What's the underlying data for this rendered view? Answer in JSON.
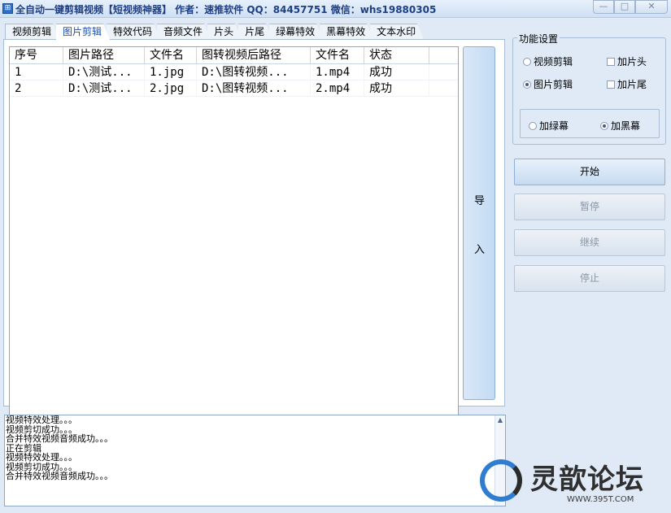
{
  "window": {
    "title": "全自动一键剪辑视频【短视频神器】   作者：速推软件  QQ：84457751  微信：whs19880305",
    "controls": {
      "minimize": "—",
      "maximize": "□",
      "close": "✕"
    }
  },
  "tabs": [
    "视频剪辑",
    "图片剪辑",
    "特效代码",
    "音频文件",
    "片头",
    "片尾",
    "绿幕特效",
    "黑幕特效",
    "文本水印"
  ],
  "active_tab": "图片剪辑",
  "table": {
    "columns": [
      "序号",
      "图片路径",
      "文件名",
      "图转视频后路径",
      "文件名",
      "状态"
    ],
    "rows": [
      [
        "1",
        "D:\\测试...",
        "1.jpg",
        "D:\\图转视频...",
        "1.mp4",
        "成功"
      ],
      [
        "2",
        "D:\\测试...",
        "2.jpg",
        "D:\\图转视频...",
        "2.mp4",
        "成功"
      ]
    ]
  },
  "import_button": {
    "char1": "导",
    "char2": "入"
  },
  "settings": {
    "title": "功能设置",
    "video_edit": "视频剪辑",
    "image_edit": "图片剪辑",
    "add_intro": "加片头",
    "add_outro": "加片尾",
    "green_screen": "加绿幕",
    "black_screen": "加黑幕"
  },
  "buttons": {
    "start": "开始",
    "pause": "暂停",
    "resume": "继续",
    "stop": "停止"
  },
  "log": [
    "视频特效处理。。。",
    "视频剪切成功。。。",
    "合并特效视频音频成功。。。",
    "正在剪辑",
    "视频特效处理。。。",
    "视频剪切成功。。。",
    "合并特效视频音频成功。。。"
  ],
  "watermark": {
    "name": "灵歆论坛",
    "url": "WWW.395T.COM"
  },
  "colors": {
    "accent": "#1f50a8",
    "window_bg": "#dfeaf6",
    "border": "#8ea6c5"
  }
}
